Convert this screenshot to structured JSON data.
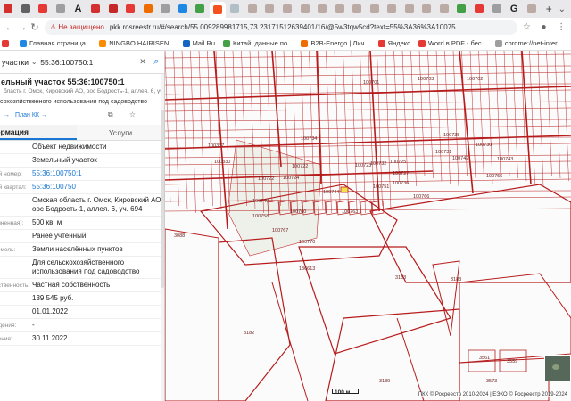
{
  "browser": {
    "tabs": [
      "",
      "",
      "",
      "",
      "A",
      "",
      "",
      "",
      "",
      "",
      "",
      "",
      "",
      "",
      "",
      "",
      "",
      "",
      "",
      "",
      "",
      "",
      "",
      "",
      "",
      "",
      "",
      "",
      "",
      "G",
      "",
      "+"
    ],
    "active_tab_index": 12,
    "url": "pkk.rosreestr.ru/#/search/55.009289981715,73.23171512639401/16/@5w3tqw5cd?text=55%3A36%3A10075...",
    "not_secure_label": "Не защищено",
    "bookmarks": [
      {
        "label": "",
        "color": "#e53935"
      },
      {
        "label": "Главная страница...",
        "color": "#1e88e5"
      },
      {
        "label": "NINGBO HAIRISEN...",
        "color": "#fb8c00"
      },
      {
        "label": "Mail.Ru",
        "color": "#1565c0"
      },
      {
        "label": "Китай: данные по...",
        "color": "#43a047"
      },
      {
        "label": "B2B-Energo | Лич...",
        "color": "#ef6c00"
      },
      {
        "label": "Яндекс",
        "color": "#e53935"
      },
      {
        "label": "Word в PDF - бес...",
        "color": "#e53935"
      },
      {
        "label": "chrome://net-inter...",
        "color": "#9e9e9e"
      }
    ]
  },
  "panel": {
    "search_category": "участки",
    "search_value": "55:36:100750:1",
    "object_title": "ельный участок 55:36:100750:1",
    "object_address_line": "бласть г. Омск, Кировский АО, оос Бодрость-1, аллея. 6, уч.",
    "object_use_line": "сохозяйственного использования под садоводство",
    "link_label": "План КК →",
    "tab_info": "формация",
    "tab_services": "Услуги",
    "rows": [
      {
        "k": "",
        "v": "Объект недвижимости",
        "link": false
      },
      {
        "k": "",
        "v": "Земельный участок",
        "link": false
      },
      {
        "k": "ый номер:",
        "v": "55:36:100750:1",
        "link": true
      },
      {
        "k": "ый квартал:",
        "v": "55:36:100750",
        "link": true
      },
      {
        "k": "",
        "v": "Омская область г. Омск, Кировский АО, оос Бодрость-1, аллея. 6, уч. 694",
        "link": false
      },
      {
        "k": "очненная):",
        "v": "500 кв. м",
        "link": false
      },
      {
        "k": "",
        "v": "Ранее учтенный",
        "link": false
      },
      {
        "k": "земель:",
        "v": "Земли населённых пунктов",
        "link": false
      },
      {
        "k": "",
        "v": "Для сельскохозяйственного использования под садоводство",
        "link": false
      },
      {
        "k": "бственность:",
        "v": "Частная собственность",
        "link": false
      },
      {
        "k": "я",
        "v": "139 545 руб.",
        "link": false
      },
      {
        "k": "",
        "v": "01.01.2022",
        "link": false
      },
      {
        "k": "ждения:",
        "v": "-",
        "link": false
      },
      {
        "k": "нения:",
        "v": "30.11.2022",
        "link": false
      }
    ]
  },
  "map": {
    "labels": [
      {
        "t": "100701"
      },
      {
        "t": "100703"
      },
      {
        "t": "100702"
      },
      {
        "t": "100337"
      },
      {
        "t": "100735"
      },
      {
        "t": "100734"
      },
      {
        "t": "100722"
      },
      {
        "t": "100723"
      },
      {
        "t": "100725"
      },
      {
        "t": "100727"
      },
      {
        "t": "100736"
      },
      {
        "t": "100730"
      },
      {
        "t": "100731"
      },
      {
        "t": "100742"
      },
      {
        "t": "100732"
      },
      {
        "t": "100743"
      },
      {
        "t": "100756"
      },
      {
        "t": "100330"
      },
      {
        "t": "100722"
      },
      {
        "t": "100724"
      },
      {
        "t": "100749"
      },
      {
        "t": "100758"
      },
      {
        "t": "100760"
      },
      {
        "t": "100763"
      },
      {
        "t": "100767"
      },
      {
        "t": "100770"
      },
      {
        "t": "100766"
      },
      {
        "t": "100744"
      },
      {
        "t": "100751"
      },
      {
        "t": "3088"
      },
      {
        "t": "136613"
      },
      {
        "t": "3183"
      },
      {
        "t": "3182"
      },
      {
        "t": "3189"
      },
      {
        "t": "3559"
      },
      {
        "t": "3561"
      },
      {
        "t": "3573"
      },
      {
        "t": "3183"
      }
    ],
    "scale_label": "100 м",
    "attribution": "ПКК © Росреестр 2010-2024 | ЕЭКО © Росреестр 2019-2024"
  }
}
